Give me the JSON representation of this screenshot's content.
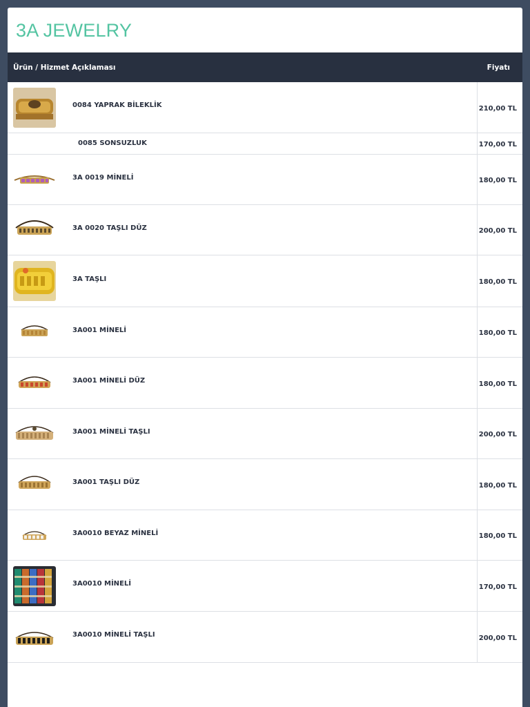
{
  "shop": {
    "name": "3A JEWELRY"
  },
  "table": {
    "header": {
      "description": "Ürün / Hizmet Açıklaması",
      "price": "Fiyatı"
    },
    "rows": [
      {
        "name": "0084 YAPRAK BİLEKLİK",
        "price": "210,00 TL",
        "image": "leaf-bracelet-photo"
      },
      {
        "name": "0085 SONSUZLUK",
        "price": "170,00 TL",
        "image": ""
      },
      {
        "name": "3A 0019 MİNELİ",
        "price": "180,00 TL",
        "image": "enamel-bracelet-photo"
      },
      {
        "name": "3A 0020 TAŞLI DÜZ",
        "price": "200,00 TL",
        "image": "stone-bracelet-photo"
      },
      {
        "name": "3A TAŞLI",
        "price": "180,00 TL",
        "image": "gold-stone-bracelet-photo"
      },
      {
        "name": "3A001 MİNELİ",
        "price": "180,00 TL",
        "image": "enamel-bracelet-photo"
      },
      {
        "name": "3A001 MİNELİ DÜZ",
        "price": "180,00 TL",
        "image": "red-enamel-bracelet-photo"
      },
      {
        "name": "3A001 MİNELİ TAŞLI",
        "price": "200,00 TL",
        "image": "enamel-stone-bracelet-photo"
      },
      {
        "name": "3A001 TAŞLI DÜZ",
        "price": "180,00 TL",
        "image": "stone-bracelet-photo"
      },
      {
        "name": "3A0010 BEYAZ MİNELİ",
        "price": "180,00 TL",
        "image": "white-enamel-bracelet-photo"
      },
      {
        "name": "3A0010 MİNELİ",
        "price": "170,00 TL",
        "image": "multicolor-bracelets-photo"
      },
      {
        "name": "3A0010 MİNELİ TAŞLI",
        "price": "200,00 TL",
        "image": "black-enamel-bracelet-photo"
      }
    ]
  },
  "colors": {
    "background": "#3e4c61",
    "brand": "#54c4a2",
    "header": "#283040",
    "gold": "#c9a24a"
  }
}
